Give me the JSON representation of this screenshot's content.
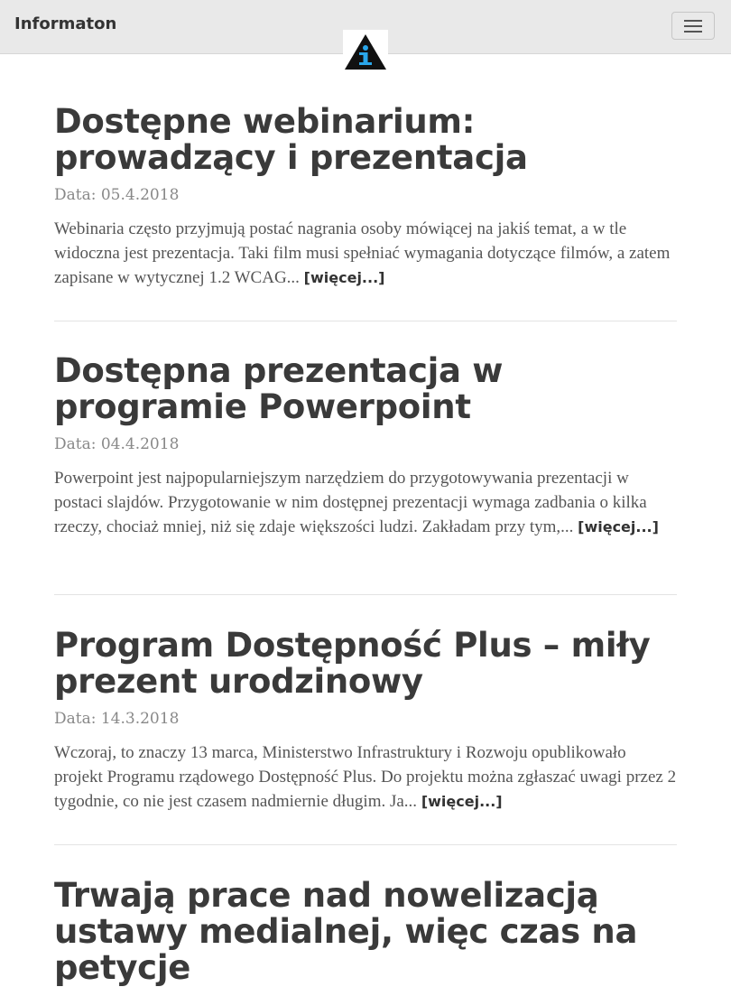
{
  "navbar": {
    "brand": "Informaton",
    "toggle_icon": "hamburger-menu-icon",
    "logo_icon": "information-triangle-icon"
  },
  "posts": [
    {
      "title": "Dostępne webinarium: prowadzący i prezentacja",
      "date": "Data: 05.4.2018",
      "excerpt": "Webinaria często przyjmują postać nagrania osoby mówiącej na jakiś temat, a w tle widoczna jest prezentacja. Taki film musi spełniać wymagania dotyczące filmów, a zatem zapisane w wytycznej 1.2 WCAG...",
      "more": "[więcej...]"
    },
    {
      "title": "Dostępna prezentacja w programie Powerpoint",
      "date": "Data: 04.4.2018",
      "excerpt": "Powerpoint jest najpopularniejszym narzędziem do przygotowywania prezentacji w postaci slajdów. Przygotowanie w nim dostępnej prezentacji wymaga zadbania o kilka rzeczy, chociaż mniej, niż się zdaje większości ludzi. Zakładam przy tym,...",
      "more": "[więcej...]"
    },
    {
      "title": "Program Dostępność Plus – miły prezent urodzinowy",
      "date": "Data: 14.3.2018",
      "excerpt": "Wczoraj, to znaczy 13 marca, Ministerstwo Infrastruktury i Rozwoju opublikowało projekt Programu rządowego Dostępność Plus. Do projektu można zgłaszać uwagi przez 2 tygodnie, co nie jest czasem nadmiernie długim. Ja...",
      "more": "[więcej...]"
    },
    {
      "title": "Trwają prace nad nowelizacją ustawy medialnej, więc czas na petycje"
    }
  ]
}
